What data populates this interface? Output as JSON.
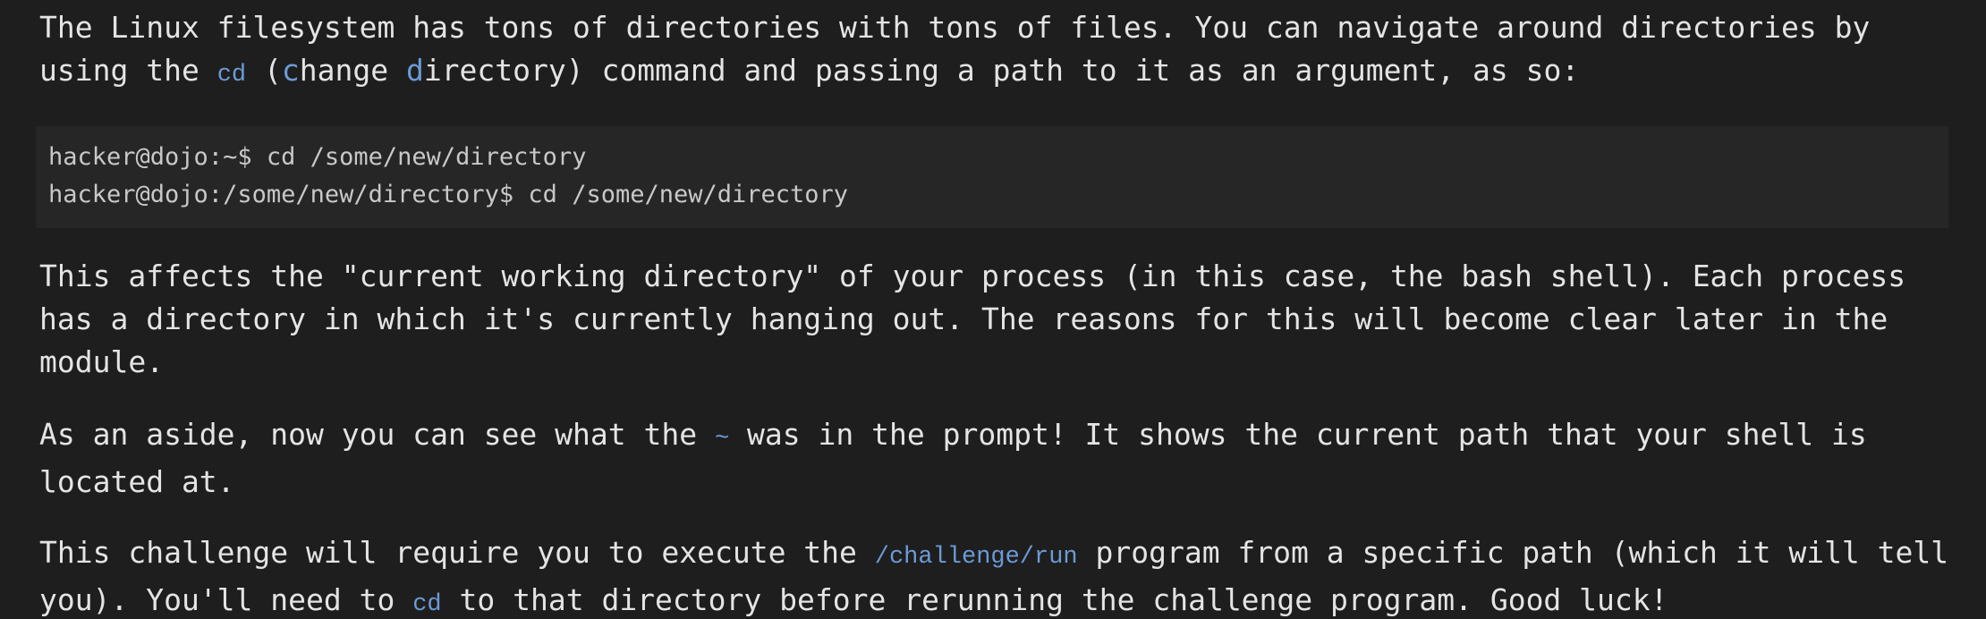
{
  "intro": {
    "before": "The Linux filesystem has tons of directories with tons of files. You can navigate around directories by using the ",
    "cmd": "cd",
    "open_paren": " (",
    "c_letter": "c",
    "c_rest": "hange ",
    "d_letter": "d",
    "after": "irectory) command and passing a path to it as an argument, as so:"
  },
  "code_example": {
    "line1": "hacker@dojo:~$ cd /some/new/directory",
    "line2": "hacker@dojo:/some/new/directory$ cd /some/new/directory"
  },
  "cwd_paragraph": {
    "text": "This affects the \"current working directory\" of your process (in this case, the bash shell). Each process has a directory in which it's currently hanging out. The reasons for this will become clear later in the module."
  },
  "aside_paragraph": {
    "before": "As an aside, now you can see what the ",
    "tilde": "~",
    "after": " was in the prompt! It shows the current path that your shell is located at."
  },
  "challenge_paragraph": {
    "before": "This challenge will require you to execute the ",
    "path": "/challenge/run",
    "middle": " program from a specific path (which it will tell you). You'll need to ",
    "cmd": "cd",
    "after": " to that directory before rerunning the challenge program. Good luck!"
  },
  "colors": {
    "background": "#1e1e1e",
    "code_background": "#262626",
    "text": "#e4e4e4",
    "accent": "#6b9bd6"
  }
}
